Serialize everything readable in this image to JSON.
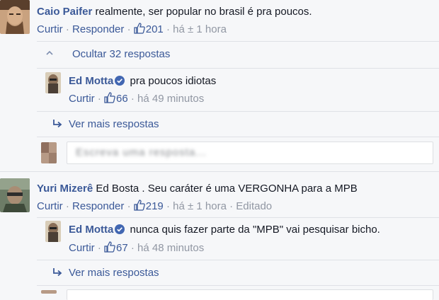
{
  "comments": [
    {
      "author": "Caio Paifer",
      "text": "realmente, ser popular no brasil é pra poucos.",
      "actions": {
        "like": "Curtir",
        "reply": "Responder"
      },
      "likes": "201",
      "time": "há ± 1 hora",
      "hide_replies": "Ocultar 32 respostas",
      "replies": [
        {
          "author": "Ed Motta",
          "text": "pra poucos idiotas",
          "like": "Curtir",
          "likes": "66",
          "time": "há 49 minutos"
        }
      ],
      "more_replies": "Ver mais respostas",
      "reply_input_placeholder": "Escreva uma resposta..."
    },
    {
      "author": "Yuri Mizerê",
      "text": "Ed Bosta . Seu caráter é uma VERGONHA para a MPB",
      "actions": {
        "like": "Curtir",
        "reply": "Responder"
      },
      "likes": "219",
      "time": "há ± 1 hora",
      "edited": "Editado",
      "replies": [
        {
          "author": "Ed Motta",
          "text": "nunca quis fazer parte da \"MPB\" vai pesquisar bicho.",
          "like": "Curtir",
          "likes": "67",
          "time": "há 48 minutos"
        }
      ],
      "more_replies": "Ver mais respostas"
    }
  ],
  "separator": " · ",
  "colors": {
    "link": "#3b5998",
    "meta": "#9197a3",
    "verified": "#4267b2"
  }
}
